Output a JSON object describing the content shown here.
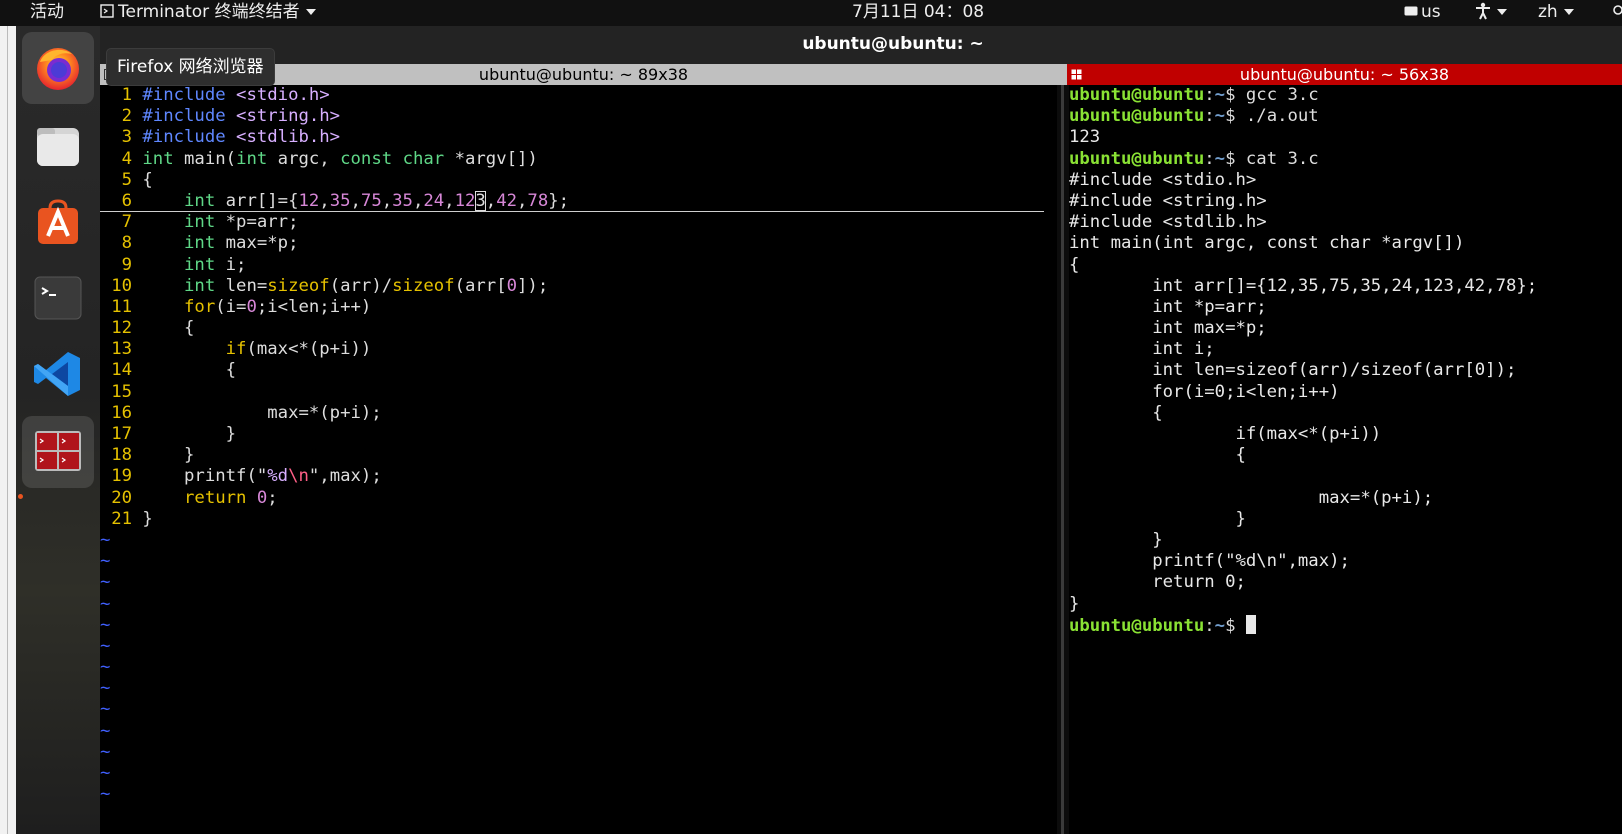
{
  "topbar": {
    "activities": "活动",
    "app_menu": "Terminator 终端终结者",
    "clock": "7月11日  04：08",
    "keyboard": "us",
    "language": "zh"
  },
  "tooltip": "Firefox 网络浏览器",
  "window": {
    "title": "ubuntu@ubuntu: ~"
  },
  "left_pane": {
    "title": "ubuntu@ubuntu: ~ 89x38",
    "vim_tilde_lines": 13
  },
  "right_pane": {
    "title": "ubuntu@ubuntu: ~ 56x38"
  },
  "dock": {
    "items": [
      "firefox-icon",
      "files-icon",
      "app-store-icon",
      "terminal-icon",
      "vscode-icon",
      "terminator-icon"
    ]
  },
  "vim": {
    "lines": [
      {
        "n": "1",
        "segs": [
          [
            "pre",
            "#include"
          ],
          [
            "tx",
            " "
          ],
          [
            "inc",
            "<stdio.h>"
          ]
        ]
      },
      {
        "n": "2",
        "segs": [
          [
            "pre",
            "#include"
          ],
          [
            "tx",
            " "
          ],
          [
            "inc",
            "<string.h>"
          ]
        ]
      },
      {
        "n": "3",
        "segs": [
          [
            "pre",
            "#include"
          ],
          [
            "tx",
            " "
          ],
          [
            "inc",
            "<stdlib.h>"
          ]
        ]
      },
      {
        "n": "4",
        "segs": [
          [
            "typ",
            "int"
          ],
          [
            "tx",
            " main("
          ],
          [
            "typ",
            "int"
          ],
          [
            "tx",
            " argc, "
          ],
          [
            "typ",
            "const"
          ],
          [
            "tx",
            " "
          ],
          [
            "typ",
            "char"
          ],
          [
            "tx",
            " *argv[])"
          ]
        ]
      },
      {
        "n": "5",
        "segs": [
          [
            "tx",
            "{"
          ]
        ]
      },
      {
        "n": "6",
        "cursorline": true,
        "segs": [
          [
            "tx",
            "    "
          ],
          [
            "typ",
            "int"
          ],
          [
            "tx",
            " arr[]={"
          ],
          [
            "num",
            "12"
          ],
          [
            "tx",
            ","
          ],
          [
            "num",
            "35"
          ],
          [
            "tx",
            ","
          ],
          [
            "num",
            "75"
          ],
          [
            "tx",
            ","
          ],
          [
            "num",
            "35"
          ],
          [
            "tx",
            ","
          ],
          [
            "num",
            "24"
          ],
          [
            "tx",
            ","
          ],
          [
            "num",
            "12"
          ],
          [
            "cur",
            "3"
          ],
          [
            "tx",
            ","
          ],
          [
            "num",
            "42"
          ],
          [
            "tx",
            ","
          ],
          [
            "num",
            "78"
          ],
          [
            "tx",
            "};"
          ]
        ]
      },
      {
        "n": "7",
        "segs": [
          [
            "tx",
            "    "
          ],
          [
            "typ",
            "int"
          ],
          [
            "tx",
            " *p=arr;"
          ]
        ]
      },
      {
        "n": "8",
        "segs": [
          [
            "tx",
            "    "
          ],
          [
            "typ",
            "int"
          ],
          [
            "tx",
            " max=*p;"
          ]
        ]
      },
      {
        "n": "9",
        "segs": [
          [
            "tx",
            "    "
          ],
          [
            "typ",
            "int"
          ],
          [
            "tx",
            " i;"
          ]
        ]
      },
      {
        "n": "10",
        "segs": [
          [
            "tx",
            "    "
          ],
          [
            "typ",
            "int"
          ],
          [
            "tx",
            " len="
          ],
          [
            "kw",
            "sizeof"
          ],
          [
            "tx",
            "(arr)/"
          ],
          [
            "kw",
            "sizeof"
          ],
          [
            "tx",
            "(arr["
          ],
          [
            "num",
            "0"
          ],
          [
            "tx",
            "]);"
          ]
        ]
      },
      {
        "n": "11",
        "segs": [
          [
            "tx",
            "    "
          ],
          [
            "kw",
            "for"
          ],
          [
            "tx",
            "(i="
          ],
          [
            "num",
            "0"
          ],
          [
            "tx",
            ";i<len;i++)"
          ]
        ]
      },
      {
        "n": "12",
        "segs": [
          [
            "tx",
            "    {"
          ]
        ]
      },
      {
        "n": "13",
        "segs": [
          [
            "tx",
            "        "
          ],
          [
            "kw",
            "if"
          ],
          [
            "tx",
            "(max<*(p+i))"
          ]
        ]
      },
      {
        "n": "14",
        "segs": [
          [
            "tx",
            "        {"
          ]
        ]
      },
      {
        "n": "15",
        "segs": [
          [
            "tx",
            ""
          ]
        ]
      },
      {
        "n": "16",
        "segs": [
          [
            "tx",
            "            max=*(p+i);"
          ]
        ]
      },
      {
        "n": "17",
        "segs": [
          [
            "tx",
            "        }"
          ]
        ]
      },
      {
        "n": "18",
        "segs": [
          [
            "tx",
            "    }"
          ]
        ]
      },
      {
        "n": "19",
        "segs": [
          [
            "tx",
            "    printf(\""
          ],
          [
            "inc",
            "%d"
          ],
          [
            "esc",
            "\\n"
          ],
          [
            "tx",
            "\",max);"
          ]
        ]
      },
      {
        "n": "20",
        "segs": [
          [
            "tx",
            "    "
          ],
          [
            "kw",
            "return"
          ],
          [
            "tx",
            " "
          ],
          [
            "num",
            "0"
          ],
          [
            "tx",
            ";"
          ]
        ]
      },
      {
        "n": "21",
        "segs": [
          [
            "tx",
            "}"
          ]
        ]
      }
    ]
  },
  "terminal": {
    "lines": [
      {
        "prompt": true,
        "cmd": "gcc 3.c"
      },
      {
        "prompt": true,
        "cmd": "./a.out"
      },
      {
        "text": "123"
      },
      {
        "prompt": true,
        "cmd": "cat 3.c"
      },
      {
        "text": "#include <stdio.h>"
      },
      {
        "text": "#include <string.h>"
      },
      {
        "text": "#include <stdlib.h>"
      },
      {
        "text": "int main(int argc, const char *argv[])"
      },
      {
        "text": "{"
      },
      {
        "text": "        int arr[]={12,35,75,35,24,123,42,78};"
      },
      {
        "text": "        int *p=arr;"
      },
      {
        "text": "        int max=*p;"
      },
      {
        "text": "        int i;"
      },
      {
        "text": "        int len=sizeof(arr)/sizeof(arr[0]);"
      },
      {
        "text": "        for(i=0;i<len;i++)"
      },
      {
        "text": "        {"
      },
      {
        "text": "                if(max<*(p+i))"
      },
      {
        "text": "                {"
      },
      {
        "text": ""
      },
      {
        "text": "                        max=*(p+i);"
      },
      {
        "text": "                }"
      },
      {
        "text": "        }"
      },
      {
        "text": "        printf(\"%d\\n\",max);"
      },
      {
        "text": "        return 0;"
      },
      {
        "text": "}"
      },
      {
        "prompt": true,
        "cmd": "",
        "cursor": true
      }
    ],
    "prompt_user": "ubuntu@ubuntu",
    "prompt_path": "~",
    "prompt_sym": "$ "
  }
}
